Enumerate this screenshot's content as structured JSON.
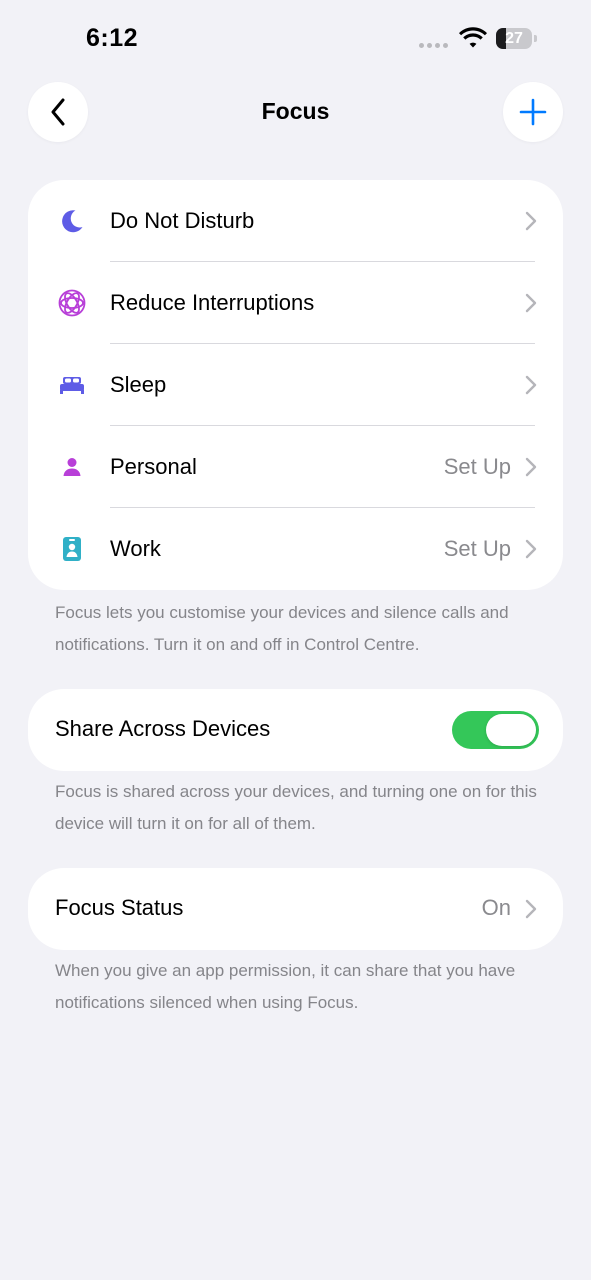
{
  "status_bar": {
    "time": "6:12",
    "battery_level": "27",
    "battery_fraction": 0.27
  },
  "nav": {
    "title": "Focus",
    "back_icon": "chevron-left-icon",
    "add_icon": "plus-icon",
    "accent_color": "#007aff"
  },
  "focus_modes": [
    {
      "label": "Do Not Disturb",
      "value": "",
      "icon": "moon-icon",
      "color": "#5e5ce6"
    },
    {
      "label": "Reduce Interruptions",
      "value": "",
      "icon": "reduce-interruptions-icon",
      "color": "#b83fd8"
    },
    {
      "label": "Sleep",
      "value": "",
      "icon": "bed-icon",
      "color": "#5e5ce6"
    },
    {
      "label": "Personal",
      "value": "Set Up",
      "icon": "person-icon",
      "color": "#b83fd8"
    },
    {
      "label": "Work",
      "value": "Set Up",
      "icon": "id-badge-icon",
      "color": "#30b0c7"
    }
  ],
  "focus_footnote": "Focus lets you customise your devices and silence calls and notifications. Turn it on and off in Control Centre.",
  "share": {
    "label": "Share Across Devices",
    "enabled": true,
    "toggle_color": "#34c759",
    "footnote": "Focus is shared across your devices, and turning one on for this device will turn it on for all of them."
  },
  "focus_status": {
    "label": "Focus Status",
    "value": "On",
    "footnote": "When you give an app permission, it can share that you have notifications silenced when using Focus."
  }
}
